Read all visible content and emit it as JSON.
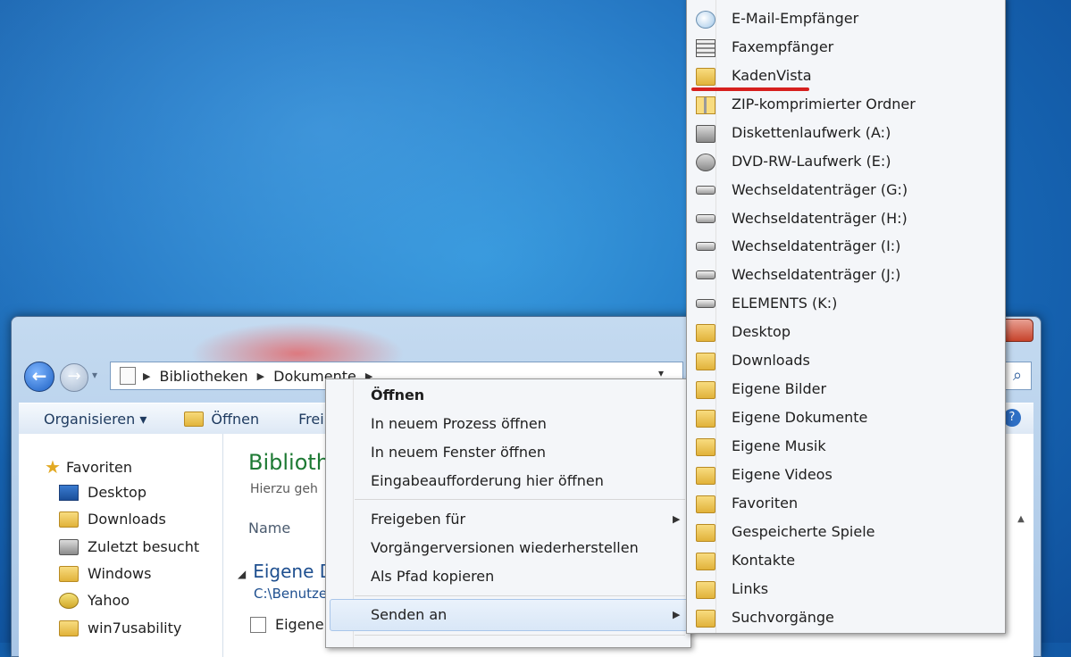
{
  "explorer": {
    "address": {
      "crumbs": [
        "Bibliotheken",
        "Dokumente"
      ]
    },
    "toolbar": {
      "organize": "Organisieren ▾",
      "open": "Öffnen",
      "share_partial": "Frei"
    },
    "nav": {
      "favorites": "Favoriten",
      "items": [
        "Desktop",
        "Downloads",
        "Zuletzt besucht",
        "Windows",
        "Yahoo",
        "win7usability"
      ]
    },
    "main": {
      "title_partial": "Biblioth",
      "subtitle_partial": "Hierzu geh",
      "column_name": "Name",
      "group_partial": "Eigene D",
      "path_partial": "C:\\Benutze",
      "row_partial": "Eigene"
    }
  },
  "context_menu": {
    "items": [
      "Öffnen",
      "In neuem Prozess öffnen",
      "In neuem Fenster öffnen",
      "Eingabeaufforderung hier öffnen",
      "Freigeben für",
      "Vorgängerversionen wiederherstellen",
      "Als Pfad kopieren",
      "Senden an"
    ]
  },
  "send_to": {
    "items": [
      "E-Mail-Empfänger",
      "Faxempfänger",
      "KadenVista",
      "ZIP-komprimierter Ordner",
      "Diskettenlaufwerk (A:)",
      "DVD-RW-Laufwerk (E:)",
      "Wechseldatenträger (G:)",
      "Wechseldatenträger (H:)",
      "Wechseldatenträger (I:)",
      "Wechseldatenträger (J:)",
      "ELEMENTS (K:)",
      "Desktop",
      "Downloads",
      "Eigene Bilder",
      "Eigene Dokumente",
      "Eigene Musik",
      "Eigene Videos",
      "Favoriten",
      "Gespeicherte Spiele",
      "Kontakte",
      "Links",
      "Suchvorgänge"
    ],
    "highlight_color": "#d6201e"
  }
}
